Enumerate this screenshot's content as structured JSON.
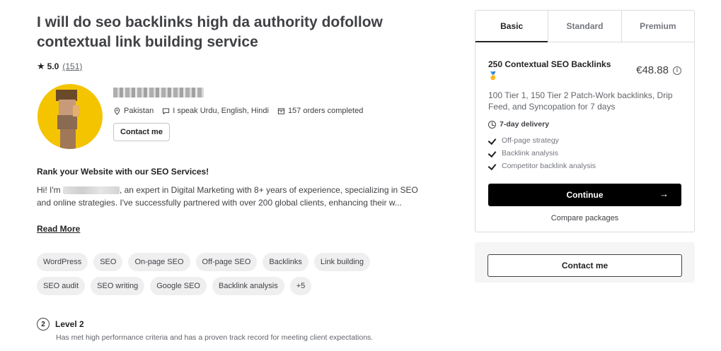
{
  "gig": {
    "title": "I will do seo backlinks high da authority dofollow contextual link building service",
    "rating": "5.0",
    "review_count": "(151)"
  },
  "seller": {
    "location": "Pakistan",
    "languages": "I speak Urdu, English, Hindi",
    "orders": "157 orders completed",
    "contact_label": "Contact me"
  },
  "about": {
    "heading": "Rank your Website with our SEO Services!",
    "text_prefix": "Hi! I'm",
    "text_body": ", an expert in Digital Marketing with 8+ years of experience, specializing in SEO and online strategies. I've successfully partnered with over 200 global clients, enhancing their w...",
    "read_more": "Read More"
  },
  "tags": {
    "row1": [
      "WordPress",
      "SEO",
      "On-page SEO",
      "Off-page SEO",
      "Backlinks",
      "Link building"
    ],
    "row2": [
      "SEO audit",
      "SEO writing",
      "Google SEO",
      "Backlink analysis",
      "+5"
    ]
  },
  "level": {
    "badge": "2",
    "title": "Level 2",
    "description": "Has met high performance criteria and has a proven track record for meeting client expectations."
  },
  "package": {
    "tabs": [
      "Basic",
      "Standard",
      "Premium"
    ],
    "active_tab": "Basic",
    "name": "250 Contextual SEO Backlinks",
    "price": "€48.88",
    "description": "100 Tier 1, 150 Tier 2 Patch-Work backlinks, Drip Feed, and Syncopation for 7 days",
    "delivery": "7-day delivery",
    "features": [
      "Off-page strategy",
      "Backlink analysis",
      "Competitor backlink analysis"
    ],
    "continue_label": "Continue",
    "compare_label": "Compare packages"
  },
  "contact_box": {
    "label": "Contact me"
  },
  "icons": {
    "star": "star-icon",
    "location": "location-pin-icon",
    "chat": "chat-bubble-icon",
    "orders": "box-icon",
    "medal": "medal-icon",
    "info": "info-icon",
    "clock": "clock-icon",
    "check": "check-icon",
    "arrow": "arrow-right-icon"
  }
}
